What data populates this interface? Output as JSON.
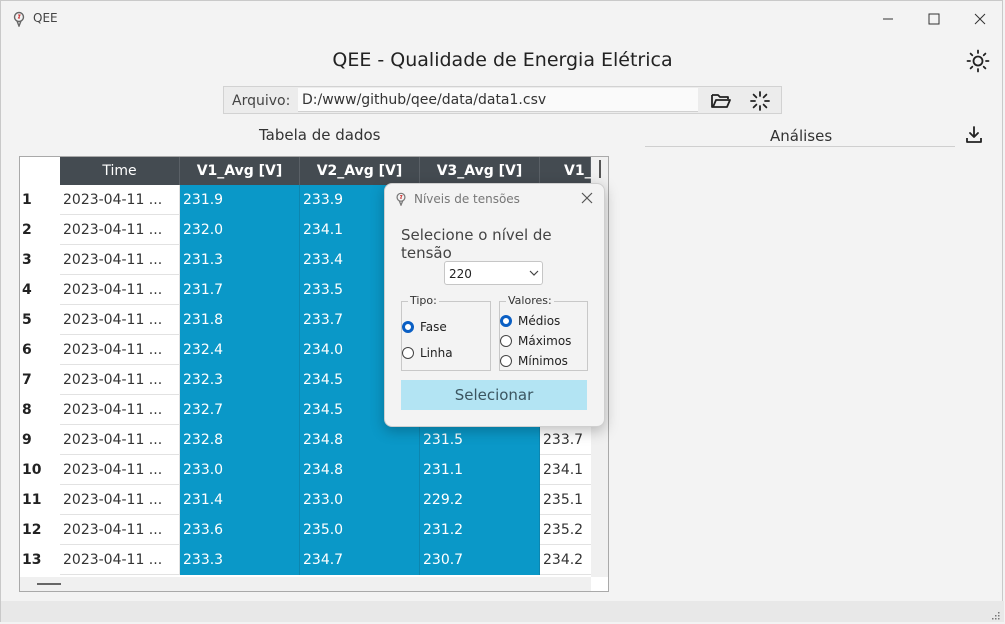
{
  "window": {
    "title": "QEE"
  },
  "header": {
    "title": "QEE - Qualidade de Energia Elétrica"
  },
  "file": {
    "label": "Arquivo:",
    "path": "D:/www/github/qee/data/data1.csv"
  },
  "table": {
    "title": "Tabela de dados",
    "columns": [
      "Time",
      "V1_Avg [V]",
      "V2_Avg [V]",
      "V3_Avg [V]",
      "V1_"
    ],
    "rows": [
      {
        "n": "1",
        "time": "2023-04-11 ...",
        "v1": "231.9",
        "v2": "233.9",
        "v3": "",
        "v4": ""
      },
      {
        "n": "2",
        "time": "2023-04-11 ...",
        "v1": "232.0",
        "v2": "234.1",
        "v3": "",
        "v4": ""
      },
      {
        "n": "3",
        "time": "2023-04-11 ...",
        "v1": "231.3",
        "v2": "233.4",
        "v3": "",
        "v4": ""
      },
      {
        "n": "4",
        "time": "2023-04-11 ...",
        "v1": "231.7",
        "v2": "233.5",
        "v3": "",
        "v4": ""
      },
      {
        "n": "5",
        "time": "2023-04-11 ...",
        "v1": "231.8",
        "v2": "233.7",
        "v3": "",
        "v4": ""
      },
      {
        "n": "6",
        "time": "2023-04-11 ...",
        "v1": "232.4",
        "v2": "234.0",
        "v3": "",
        "v4": ""
      },
      {
        "n": "7",
        "time": "2023-04-11 ...",
        "v1": "232.3",
        "v2": "234.5",
        "v3": "",
        "v4": ""
      },
      {
        "n": "8",
        "time": "2023-04-11 ...",
        "v1": "232.7",
        "v2": "234.5",
        "v3": "",
        "v4": ""
      },
      {
        "n": "9",
        "time": "2023-04-11 ...",
        "v1": "232.8",
        "v2": "234.8",
        "v3": "231.5",
        "v4": "233.7"
      },
      {
        "n": "10",
        "time": "2023-04-11 ...",
        "v1": "233.0",
        "v2": "234.8",
        "v3": "231.1",
        "v4": "234.1"
      },
      {
        "n": "11",
        "time": "2023-04-11 ...",
        "v1": "231.4",
        "v2": "233.0",
        "v3": "229.2",
        "v4": "235.1"
      },
      {
        "n": "12",
        "time": "2023-04-11 ...",
        "v1": "233.6",
        "v2": "235.0",
        "v3": "231.2",
        "v4": "235.2"
      },
      {
        "n": "13",
        "time": "2023-04-11 ...",
        "v1": "233.3",
        "v2": "234.7",
        "v3": "230.7",
        "v4": "234.2"
      }
    ]
  },
  "analises": {
    "title": "Análises"
  },
  "dialog": {
    "title": "Níveis de tensões",
    "prompt": "Selecione o nível de tensão",
    "level": "220",
    "tipo": {
      "label": "Tipo:",
      "options": [
        "Fase",
        "Linha"
      ],
      "selected": "Fase"
    },
    "valores": {
      "label": "Valores:",
      "options": [
        "Médios",
        "Máximos",
        "Mínimos"
      ],
      "selected": "Médios"
    },
    "button": "Selecionar"
  },
  "colors": {
    "selected_cell": "#0a98c8",
    "header": "#444b51",
    "button": "#b3e4f3"
  },
  "icons": [
    "app-icon",
    "minimize-icon",
    "maximize-icon",
    "close-icon",
    "sun-icon",
    "folder-open-icon",
    "loader-icon",
    "download-icon"
  ]
}
